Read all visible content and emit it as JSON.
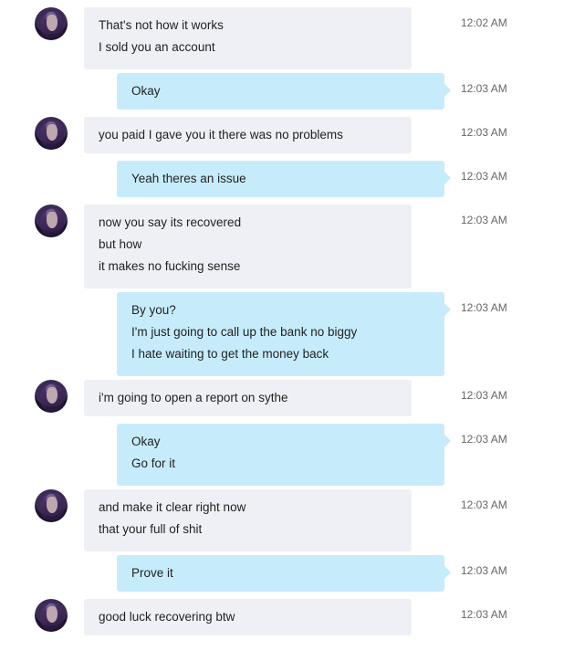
{
  "avatar_icon": "user-avatar",
  "colors": {
    "incoming_bubble": "#eef0f5",
    "outgoing_bubble": "#c6ecfb",
    "timestamp": "#666666"
  },
  "messages": [
    {
      "direction": "in",
      "lines": [
        "That's not how it works",
        "I sold you an account"
      ],
      "time": "12:02 AM"
    },
    {
      "direction": "out",
      "lines": [
        "Okay"
      ],
      "time": "12:03 AM"
    },
    {
      "direction": "in",
      "lines": [
        "you paid I gave you it there was no problems"
      ],
      "time": "12:03 AM"
    },
    {
      "direction": "out",
      "lines": [
        "Yeah theres an issue"
      ],
      "time": "12:03 AM"
    },
    {
      "direction": "in",
      "lines": [
        "now you say its recovered",
        "but how",
        "it makes no fucking sense"
      ],
      "time": "12:03 AM"
    },
    {
      "direction": "out",
      "lines": [
        "By you?",
        "I'm just going to call up the bank no biggy",
        "I hate waiting to get the money back"
      ],
      "time": "12:03 AM"
    },
    {
      "direction": "in",
      "lines": [
        "i'm going to open a report on sythe"
      ],
      "time": "12:03 AM"
    },
    {
      "direction": "out",
      "lines": [
        "Okay",
        "Go for it"
      ],
      "time": "12:03 AM"
    },
    {
      "direction": "in",
      "lines": [
        "and make it clear right now",
        "that your full of shit"
      ],
      "time": "12:03 AM"
    },
    {
      "direction": "out",
      "lines": [
        "Prove it"
      ],
      "time": "12:03 AM"
    },
    {
      "direction": "in",
      "lines": [
        "good luck recovering btw"
      ],
      "time": "12:03 AM"
    }
  ]
}
